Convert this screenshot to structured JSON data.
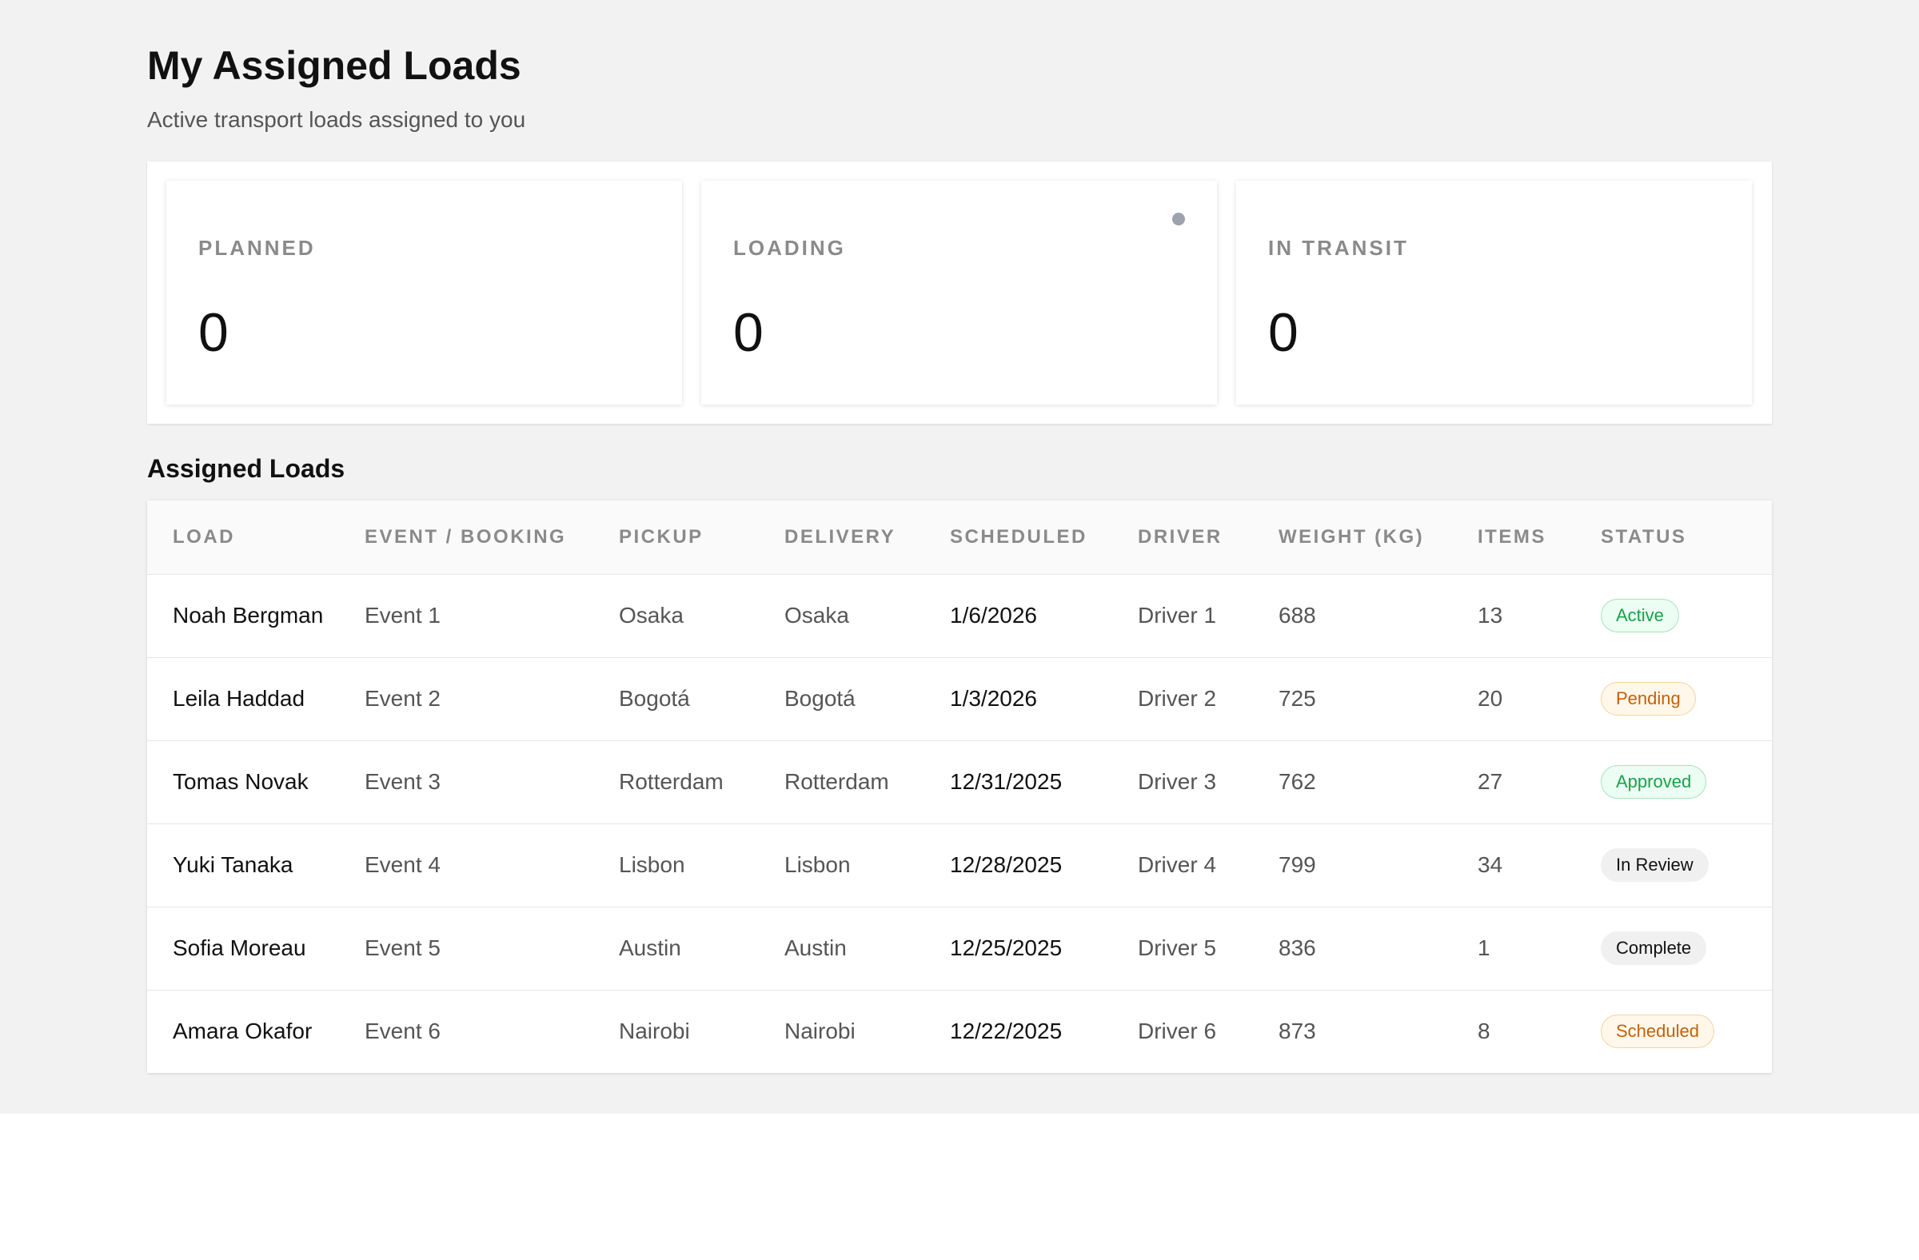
{
  "header": {
    "title": "My Assigned Loads",
    "subtitle": "Active transport loads assigned to you"
  },
  "stats": [
    {
      "label": "PLANNED",
      "value": "0"
    },
    {
      "label": "LOADING",
      "value": "0"
    },
    {
      "label": "IN TRANSIT",
      "value": "0"
    }
  ],
  "table": {
    "title": "Assigned Loads",
    "columns": [
      "LOAD",
      "EVENT / BOOKING",
      "PICKUP",
      "DELIVERY",
      "SCHEDULED",
      "DRIVER",
      "WEIGHT (KG)",
      "ITEMS",
      "STATUS"
    ],
    "rows": [
      {
        "load": "Noah Bergman",
        "event": "Event 1",
        "pickup": "Osaka",
        "delivery": "Osaka",
        "scheduled": "1/6/2026",
        "driver": "Driver 1",
        "weight": "688",
        "items": "13",
        "status": "Active"
      },
      {
        "load": "Leila Haddad",
        "event": "Event 2",
        "pickup": "Bogotá",
        "delivery": "Bogotá",
        "scheduled": "1/3/2026",
        "driver": "Driver 2",
        "weight": "725",
        "items": "20",
        "status": "Pending"
      },
      {
        "load": "Tomas Novak",
        "event": "Event 3",
        "pickup": "Rotterdam",
        "delivery": "Rotterdam",
        "scheduled": "12/31/2025",
        "driver": "Driver 3",
        "weight": "762",
        "items": "27",
        "status": "Approved"
      },
      {
        "load": "Yuki Tanaka",
        "event": "Event 4",
        "pickup": "Lisbon",
        "delivery": "Lisbon",
        "scheduled": "12/28/2025",
        "driver": "Driver 4",
        "weight": "799",
        "items": "34",
        "status": "In Review"
      },
      {
        "load": "Sofia Moreau",
        "event": "Event 5",
        "pickup": "Austin",
        "delivery": "Austin",
        "scheduled": "12/25/2025",
        "driver": "Driver 5",
        "weight": "836",
        "items": "1",
        "status": "Complete"
      },
      {
        "load": "Amara Okafor",
        "event": "Event 6",
        "pickup": "Nairobi",
        "delivery": "Nairobi",
        "scheduled": "12/22/2025",
        "driver": "Driver 6",
        "weight": "873",
        "items": "8",
        "status": "Scheduled"
      }
    ]
  },
  "colors": {
    "page_background": "#f2f2f2",
    "status_green": "#16a34a",
    "status_orange": "#c2620a",
    "status_gray": "#111111",
    "indicator_dot": "#9ca3af"
  },
  "icons": {
    "loading_indicator": "status-dot-icon"
  }
}
